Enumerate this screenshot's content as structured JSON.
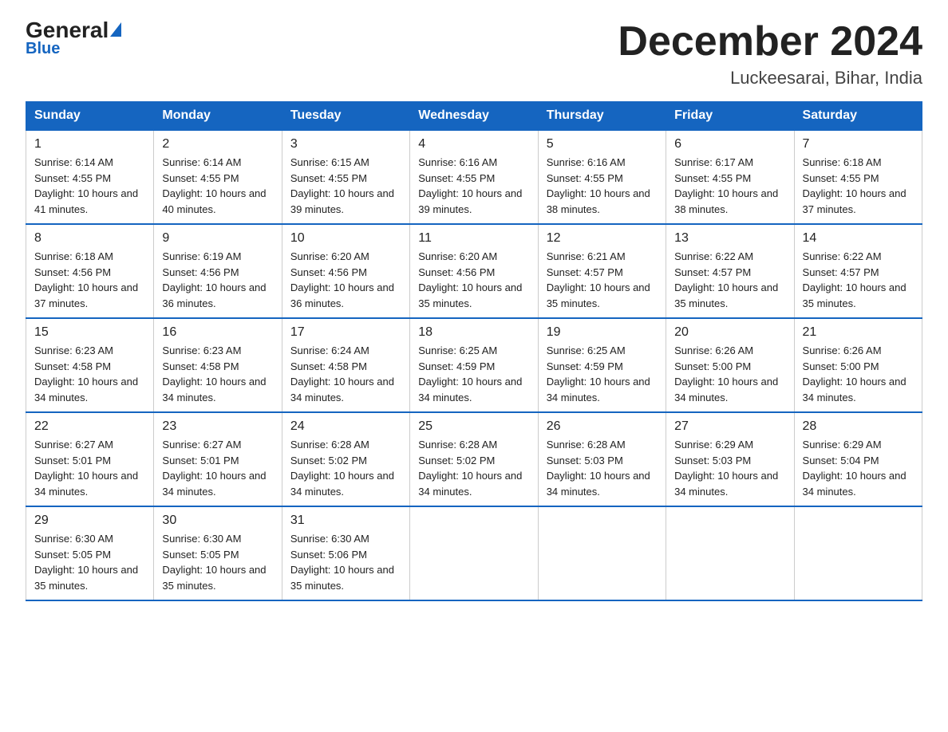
{
  "header": {
    "logo": {
      "general": "General",
      "triangle": "",
      "blue": "Blue"
    },
    "title": "December 2024",
    "location": "Luckeesarai, Bihar, India"
  },
  "calendar": {
    "columns": [
      "Sunday",
      "Monday",
      "Tuesday",
      "Wednesday",
      "Thursday",
      "Friday",
      "Saturday"
    ],
    "rows": [
      [
        {
          "day": "1",
          "sunrise": "6:14 AM",
          "sunset": "4:55 PM",
          "daylight": "10 hours and 41 minutes."
        },
        {
          "day": "2",
          "sunrise": "6:14 AM",
          "sunset": "4:55 PM",
          "daylight": "10 hours and 40 minutes."
        },
        {
          "day": "3",
          "sunrise": "6:15 AM",
          "sunset": "4:55 PM",
          "daylight": "10 hours and 39 minutes."
        },
        {
          "day": "4",
          "sunrise": "6:16 AM",
          "sunset": "4:55 PM",
          "daylight": "10 hours and 39 minutes."
        },
        {
          "day": "5",
          "sunrise": "6:16 AM",
          "sunset": "4:55 PM",
          "daylight": "10 hours and 38 minutes."
        },
        {
          "day": "6",
          "sunrise": "6:17 AM",
          "sunset": "4:55 PM",
          "daylight": "10 hours and 38 minutes."
        },
        {
          "day": "7",
          "sunrise": "6:18 AM",
          "sunset": "4:55 PM",
          "daylight": "10 hours and 37 minutes."
        }
      ],
      [
        {
          "day": "8",
          "sunrise": "6:18 AM",
          "sunset": "4:56 PM",
          "daylight": "10 hours and 37 minutes."
        },
        {
          "day": "9",
          "sunrise": "6:19 AM",
          "sunset": "4:56 PM",
          "daylight": "10 hours and 36 minutes."
        },
        {
          "day": "10",
          "sunrise": "6:20 AM",
          "sunset": "4:56 PM",
          "daylight": "10 hours and 36 minutes."
        },
        {
          "day": "11",
          "sunrise": "6:20 AM",
          "sunset": "4:56 PM",
          "daylight": "10 hours and 35 minutes."
        },
        {
          "day": "12",
          "sunrise": "6:21 AM",
          "sunset": "4:57 PM",
          "daylight": "10 hours and 35 minutes."
        },
        {
          "day": "13",
          "sunrise": "6:22 AM",
          "sunset": "4:57 PM",
          "daylight": "10 hours and 35 minutes."
        },
        {
          "day": "14",
          "sunrise": "6:22 AM",
          "sunset": "4:57 PM",
          "daylight": "10 hours and 35 minutes."
        }
      ],
      [
        {
          "day": "15",
          "sunrise": "6:23 AM",
          "sunset": "4:58 PM",
          "daylight": "10 hours and 34 minutes."
        },
        {
          "day": "16",
          "sunrise": "6:23 AM",
          "sunset": "4:58 PM",
          "daylight": "10 hours and 34 minutes."
        },
        {
          "day": "17",
          "sunrise": "6:24 AM",
          "sunset": "4:58 PM",
          "daylight": "10 hours and 34 minutes."
        },
        {
          "day": "18",
          "sunrise": "6:25 AM",
          "sunset": "4:59 PM",
          "daylight": "10 hours and 34 minutes."
        },
        {
          "day": "19",
          "sunrise": "6:25 AM",
          "sunset": "4:59 PM",
          "daylight": "10 hours and 34 minutes."
        },
        {
          "day": "20",
          "sunrise": "6:26 AM",
          "sunset": "5:00 PM",
          "daylight": "10 hours and 34 minutes."
        },
        {
          "day": "21",
          "sunrise": "6:26 AM",
          "sunset": "5:00 PM",
          "daylight": "10 hours and 34 minutes."
        }
      ],
      [
        {
          "day": "22",
          "sunrise": "6:27 AM",
          "sunset": "5:01 PM",
          "daylight": "10 hours and 34 minutes."
        },
        {
          "day": "23",
          "sunrise": "6:27 AM",
          "sunset": "5:01 PM",
          "daylight": "10 hours and 34 minutes."
        },
        {
          "day": "24",
          "sunrise": "6:28 AM",
          "sunset": "5:02 PM",
          "daylight": "10 hours and 34 minutes."
        },
        {
          "day": "25",
          "sunrise": "6:28 AM",
          "sunset": "5:02 PM",
          "daylight": "10 hours and 34 minutes."
        },
        {
          "day": "26",
          "sunrise": "6:28 AM",
          "sunset": "5:03 PM",
          "daylight": "10 hours and 34 minutes."
        },
        {
          "day": "27",
          "sunrise": "6:29 AM",
          "sunset": "5:03 PM",
          "daylight": "10 hours and 34 minutes."
        },
        {
          "day": "28",
          "sunrise": "6:29 AM",
          "sunset": "5:04 PM",
          "daylight": "10 hours and 34 minutes."
        }
      ],
      [
        {
          "day": "29",
          "sunrise": "6:30 AM",
          "sunset": "5:05 PM",
          "daylight": "10 hours and 35 minutes."
        },
        {
          "day": "30",
          "sunrise": "6:30 AM",
          "sunset": "5:05 PM",
          "daylight": "10 hours and 35 minutes."
        },
        {
          "day": "31",
          "sunrise": "6:30 AM",
          "sunset": "5:06 PM",
          "daylight": "10 hours and 35 minutes."
        },
        null,
        null,
        null,
        null
      ]
    ]
  }
}
